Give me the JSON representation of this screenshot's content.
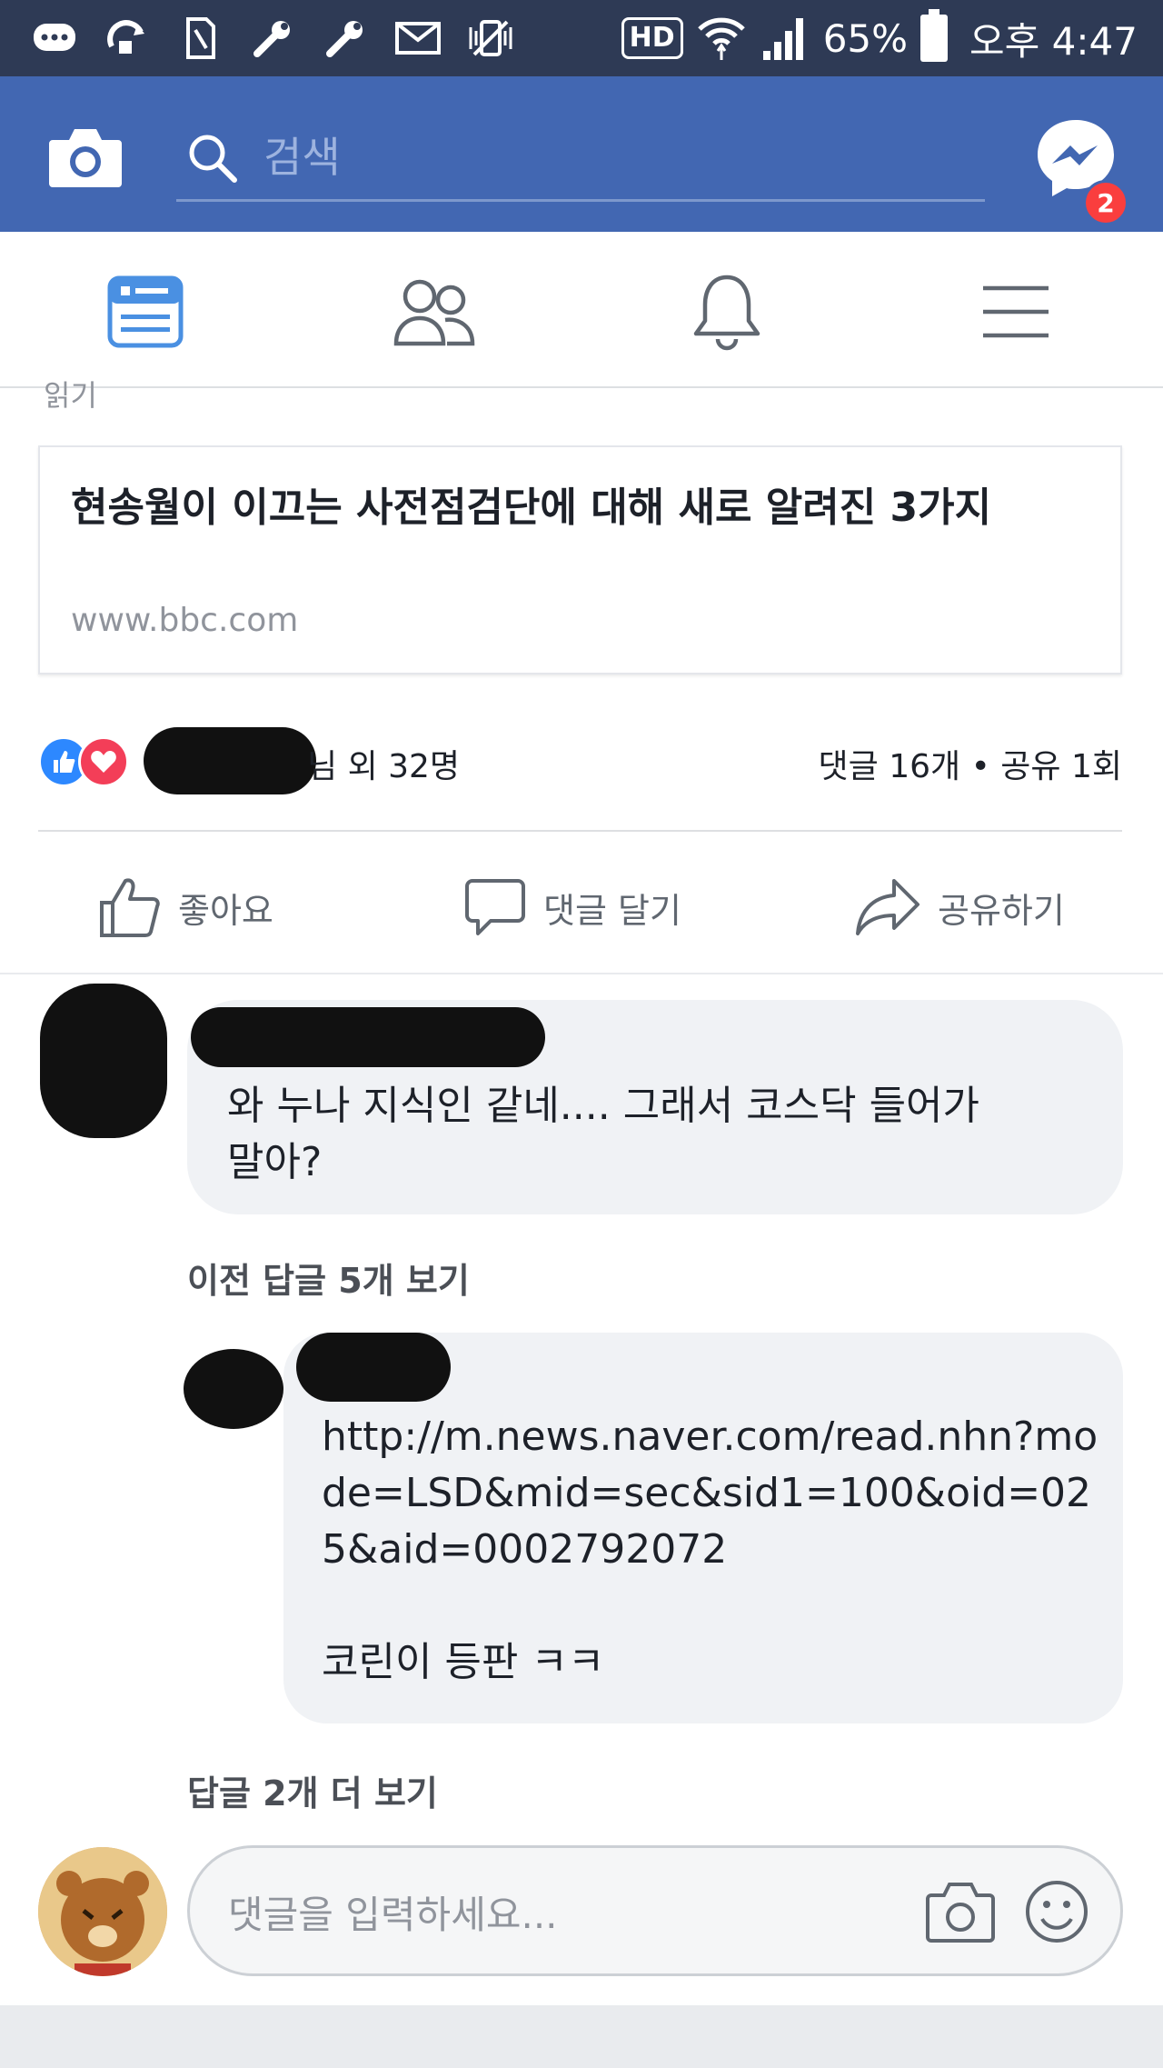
{
  "status_bar": {
    "battery": "65%",
    "time": "오후 4:47",
    "hd_label": "HD",
    "icons": [
      "chat-bubble-icon",
      "sync-icon",
      "sim-icon",
      "wrench-icon",
      "wrench-icon",
      "mail-icon",
      "vibrate-icon",
      "hd-icon",
      "wifi-icon",
      "signal-icon",
      "battery-icon"
    ]
  },
  "header": {
    "search_placeholder": "검색",
    "messenger_badge": "2",
    "colors": {
      "brand": "#4267b2",
      "badge": "#fa3e3e"
    }
  },
  "nav": {
    "tabs": [
      "news-feed-icon",
      "friends-icon",
      "notifications-icon",
      "menu-icon"
    ],
    "active_index": 0,
    "active_color": "#4a90e2"
  },
  "post": {
    "cut_text": "읽기",
    "link_card": {
      "title": "현송월이 이끄는 사전점검단에 대해 새로 알려진 3가지",
      "domain": "www.bbc.com"
    },
    "reactions": {
      "names_suffix": "님 외 32명",
      "stats": "댓글 16개 • 공유 1회"
    },
    "actions": {
      "like": "좋아요",
      "comment": "댓글 달기",
      "share": "공유하기"
    }
  },
  "comments": {
    "first": {
      "text": "와 누나 지식인 같네.... 그래서 코스닥 들어가 말아?"
    },
    "view_previous_replies": "이전 답글 5개 보기",
    "reply": {
      "text": "http://m.news.naver.com/read.nhn?mode=LSD&mid=sec&sid1=100&oid=025&aid=0002792072\n\n코린이 등판 ㅋㅋ"
    },
    "view_more_replies": "답글 2개 더 보기"
  },
  "composer": {
    "placeholder": "댓글을 입력하세요..."
  }
}
